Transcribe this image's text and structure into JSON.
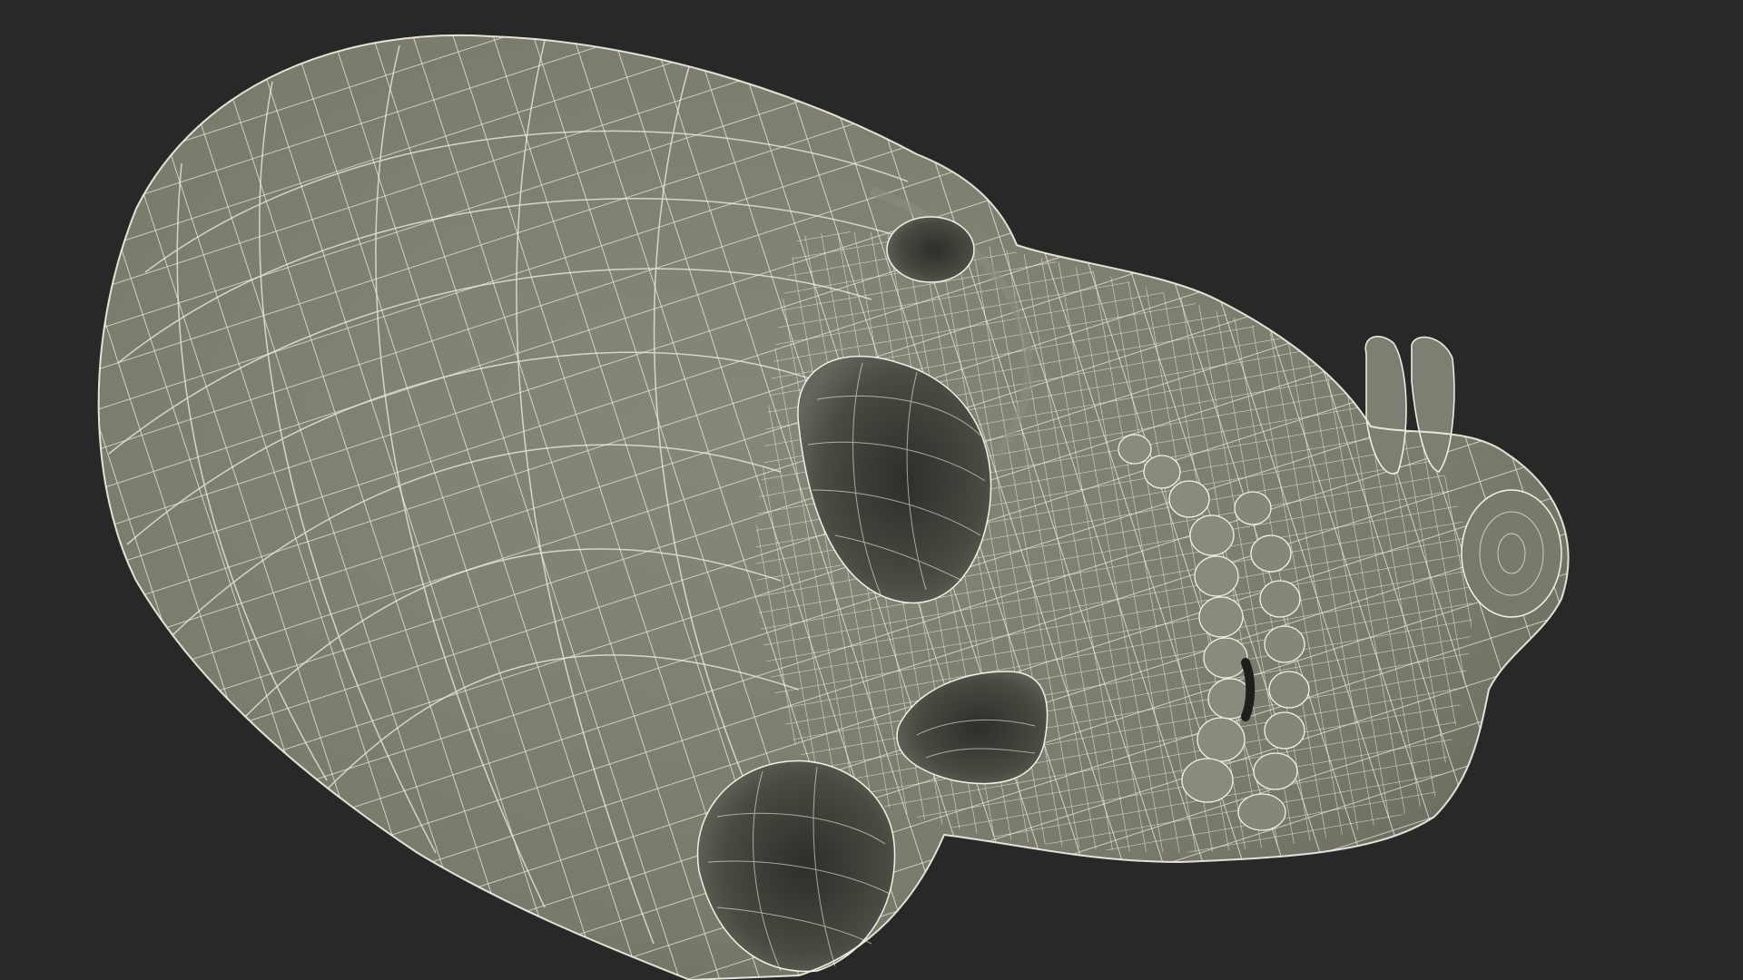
{
  "scene": {
    "background_color": "#282828",
    "mesh_fill_color": "#7a7a6c",
    "mesh_shadow_color": "#3d3d36",
    "wireframe_color": "#f2f2e6",
    "subject": "wireframe-skull-model"
  }
}
